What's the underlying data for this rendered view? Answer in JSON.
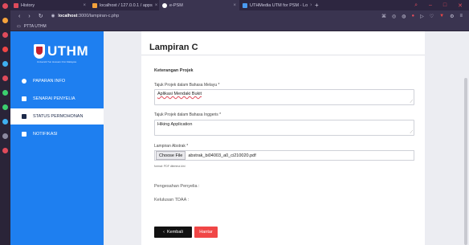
{
  "browser": {
    "tabs": [
      {
        "label": "History",
        "color": "#e04b5b"
      },
      {
        "label": "localhost / 127.0.0.1 / apps",
        "color": "#f4a23b"
      },
      {
        "label": "e-PSM",
        "color": "#ffffff"
      },
      {
        "label": "UTHMedia UTM for PSM - Lo",
        "color": "#4a9af0"
      }
    ],
    "new_tab": "+",
    "address_host": "localhost",
    "address_path": ":3000/lampiran-c.php",
    "bookmark": "PTTA UTHM"
  },
  "sidebar": {
    "logo_text": "UTHM",
    "logo_sub": "Universiti Tun Hussein Onn Malaysia",
    "items": [
      {
        "label": "PAPARAN INFO",
        "icon": "info-icon"
      },
      {
        "label": "SENARAI PENYELIA",
        "icon": "user-icon"
      },
      {
        "label": "STATUS PERMOHONAN",
        "icon": "folder-icon"
      },
      {
        "label": "NOTIFIKASI",
        "icon": "bell-icon"
      }
    ]
  },
  "page": {
    "title": "Lampiran C",
    "section": "Keterangan Projek",
    "field1_label": "Tajuk Projek dalam Bahasa Melayu *",
    "field1_value": "Aplikasi Mendaki Bukit",
    "field2_label": "Tajuk Projek dalam Bahasa Inggeris *",
    "field2_value": "Hiking Application",
    "file_label": "Lampiran Abstrak *",
    "file_button": "Choose File",
    "file_name": "abstrak_bi04003_a0_ci210020.pdf",
    "file_hint": "format: PDF diterima kini",
    "pengesahan": "Pengesahan Penyelia :",
    "kelulusan": "Kelulusan TDAA :",
    "back_label": "Kembali",
    "send_label": "Hantar"
  }
}
